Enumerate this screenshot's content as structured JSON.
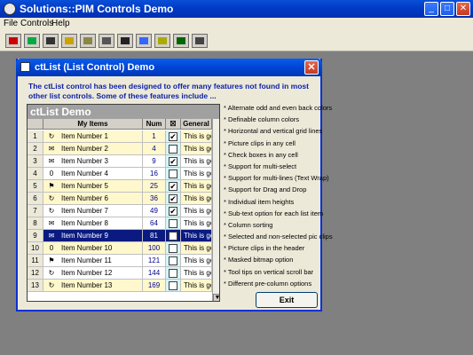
{
  "app": {
    "title": "Solutions::PIM Controls Demo",
    "menu": [
      "File",
      "Controls",
      "Help"
    ],
    "min_glyph": "_",
    "max_glyph": "□",
    "close_glyph": "✕"
  },
  "toolbar": {
    "icons": [
      "list-icon",
      "grid-icon",
      "hourglass-icon",
      "bar-icon",
      "panel-icon",
      "gauge-icon",
      "columns-icon",
      "label-icon",
      "text-icon",
      "edit-icon",
      "window-icon"
    ]
  },
  "dialog": {
    "title": "ctList (List Control) Demo",
    "close_glyph": "✕",
    "intro": "The ctList control has been designed to offer many features not found in most other list controls. Some of these features include ...",
    "exit_label": "Exit"
  },
  "list": {
    "caption": "ctList Demo",
    "columns": [
      "My Items",
      "Num",
      "☒",
      "General"
    ],
    "rows": [
      {
        "n": "1",
        "item": "Item Number 1",
        "num": "1",
        "checked": true,
        "gen": "This is gene...",
        "bg": "#fff8cc",
        "icon": "↻"
      },
      {
        "n": "2",
        "item": "Item Number 2",
        "num": "4",
        "checked": false,
        "gen": "This is gene...",
        "bg": "#fff8cc",
        "icon": "✉"
      },
      {
        "n": "3",
        "item": "Item Number 3",
        "num": "9",
        "checked": true,
        "gen": "This is gene...",
        "bg": "#ffffff",
        "icon": "✉"
      },
      {
        "n": "4",
        "item": "Item Number 4",
        "num": "16",
        "checked": false,
        "gen": "This is gene...",
        "bg": "#ffffff",
        "icon": "0"
      },
      {
        "n": "5",
        "item": "Item Number 5",
        "num": "25",
        "checked": true,
        "gen": "This is gene...",
        "bg": "#fff8cc",
        "icon": "⚑"
      },
      {
        "n": "6",
        "item": "Item Number 6",
        "num": "36",
        "checked": true,
        "gen": "This is gene...",
        "bg": "#fff8cc",
        "icon": "↻"
      },
      {
        "n": "7",
        "item": "Item Number 7",
        "num": "49",
        "checked": true,
        "gen": "This is gene...",
        "bg": "#ffffff",
        "icon": "↻"
      },
      {
        "n": "8",
        "item": "Item Number 8",
        "num": "64",
        "checked": false,
        "gen": "This is gene...",
        "bg": "#ffffff",
        "icon": "✉"
      },
      {
        "n": "9",
        "item": "Item Number 9",
        "num": "81",
        "checked": false,
        "gen": "This is gene...",
        "bg": "#0a1a80",
        "icon": "✉",
        "selected": true
      },
      {
        "n": "10",
        "item": "Item Number 10",
        "num": "100",
        "checked": false,
        "gen": "This is gene...",
        "bg": "#fff8cc",
        "icon": "0"
      },
      {
        "n": "11",
        "item": "Item Number 11",
        "num": "121",
        "checked": false,
        "gen": "This is gene...",
        "bg": "#ffffff",
        "icon": "⚑"
      },
      {
        "n": "12",
        "item": "Item Number 12",
        "num": "144",
        "checked": false,
        "gen": "This is gene...",
        "bg": "#ffffff",
        "icon": "↻"
      },
      {
        "n": "13",
        "item": "Item Number 13",
        "num": "169",
        "checked": false,
        "gen": "This is gene...",
        "bg": "#fff8cc",
        "icon": "↻"
      }
    ]
  },
  "features": [
    "* Alternate odd and even back colors",
    "* Definable column colors",
    "* Horizontal and vertical grid lines",
    "* Picture clips in any cell",
    "* Check boxes in any cell",
    "* Support for multi-select",
    "* Support for multi-lines (Text Wrap)",
    "* Support for Drag and Drop",
    "* Individual item heights",
    "* Sub-text option for each list item",
    "* Column sorting",
    "* Selected and non-selected pic clips",
    "* Picture clips in the header",
    "* Masked bitmap option",
    "* Tool tips on vertical scroll bar",
    "* Different pre-column options"
  ],
  "scroll_down_glyph": "▼",
  "check_glyph": "✔"
}
